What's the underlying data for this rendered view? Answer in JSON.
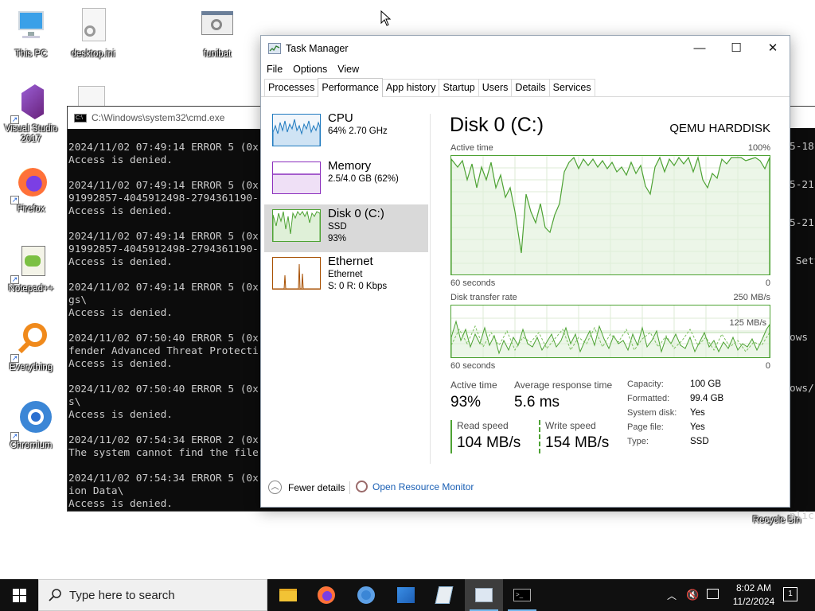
{
  "desktop": {
    "icons": [
      {
        "label": "This PC"
      },
      {
        "label": "desktop.ini"
      },
      {
        "label": "funibat"
      },
      {
        "label": "Visual Studio 2017"
      },
      {
        "label": "Firefox"
      },
      {
        "label": "Notepad++"
      },
      {
        "label": "Everything"
      },
      {
        "label": "Chromium"
      },
      {
        "label": "Recycle Bin"
      }
    ]
  },
  "cmd": {
    "title": "C:\\Windows\\system32\\cmd.exe",
    "lines": "2024/11/02 07:49:14 ERROR 5 (0x\nAccess is denied.\n\n2024/11/02 07:49:14 ERROR 5 (0x\n91992857-4045912498-2794361190-\nAccess is denied.\n\n2024/11/02 07:49:14 ERROR 5 (0x\n91992857-4045912498-2794361190-\nAccess is denied.\n\n2024/11/02 07:49:14 ERROR 5 (0x\ngs\\\nAccess is denied.\n\n2024/11/02 07:50:40 ERROR 5 (0x\nfender Advanced Threat Protecti\nAccess is denied.\n\n2024/11/02 07:50:40 ERROR 5 (0x\ns\\\nAccess is denied.\n\n2024/11/02 07:54:34 ERROR 2 (0x\nThe system cannot find the file\n\n2024/11/02 07:54:34 ERROR 5 (0x\nion Data\\\nAccess is denied.",
    "right_lines": "5-18\n\n\n5-21-\n\n\n5-21-\n\n\n Sett\n\n\n\n\n\nows\n\n\n\nows/\n\n\n\n\n\n\n\n\n\nplic"
  },
  "taskmanager": {
    "title": "Task Manager",
    "menu": [
      "File",
      "Options",
      "View"
    ],
    "tabs": [
      "Processes",
      "Performance",
      "App history",
      "Startup",
      "Users",
      "Details",
      "Services"
    ],
    "active_tab": "Performance",
    "resources": [
      {
        "name": "CPU",
        "sub1": "64%  2.70 GHz",
        "sub2": "",
        "sub3": "",
        "color": "#1f7abf"
      },
      {
        "name": "Memory",
        "sub1": "2.5/4.0 GB (62%)",
        "sub2": "",
        "sub3": "",
        "color": "#8b2fbd"
      },
      {
        "name": "Disk 0 (C:)",
        "sub1": "SSD",
        "sub2": "93%",
        "sub3": "",
        "color": "#4da233"
      },
      {
        "name": "Ethernet",
        "sub1": "Ethernet",
        "sub2": "S: 0  R: 0 Kbps",
        "sub3": "",
        "color": "#a74f01"
      }
    ],
    "selected_resource": "Disk 0 (C:)",
    "detail": {
      "heading": "Disk 0 (C:)",
      "model": "QEMU HARDDISK",
      "active_time_label": "Active time",
      "active_time_max": "100%",
      "axis_left": "60 seconds",
      "axis_right": "0",
      "transfer_label": "Disk transfer rate",
      "transfer_max": "250 MB/s",
      "transfer_mid": "125 MB/s",
      "axis2_left": "60 seconds",
      "axis2_right": "0",
      "active_time_stat_label": "Active time",
      "active_time_stat": "93%",
      "avg_resp_label": "Average response time",
      "avg_resp": "5.6 ms",
      "read_label": "Read speed",
      "read": "104 MB/s",
      "write_label": "Write speed",
      "write": "154 MB/s",
      "props": [
        {
          "k": "Capacity:",
          "v": "100 GB"
        },
        {
          "k": "Formatted:",
          "v": "99.4 GB"
        },
        {
          "k": "System disk:",
          "v": "Yes"
        },
        {
          "k": "Page file:",
          "v": "Yes"
        },
        {
          "k": "Type:",
          "v": "SSD"
        }
      ]
    },
    "footer": {
      "fewer": "Fewer details",
      "monitor": "Open Resource Monitor"
    }
  },
  "taskbar": {
    "search_placeholder": "Type here to search",
    "time": "8:02 AM",
    "date": "11/2/2024",
    "notification_count": "1"
  }
}
